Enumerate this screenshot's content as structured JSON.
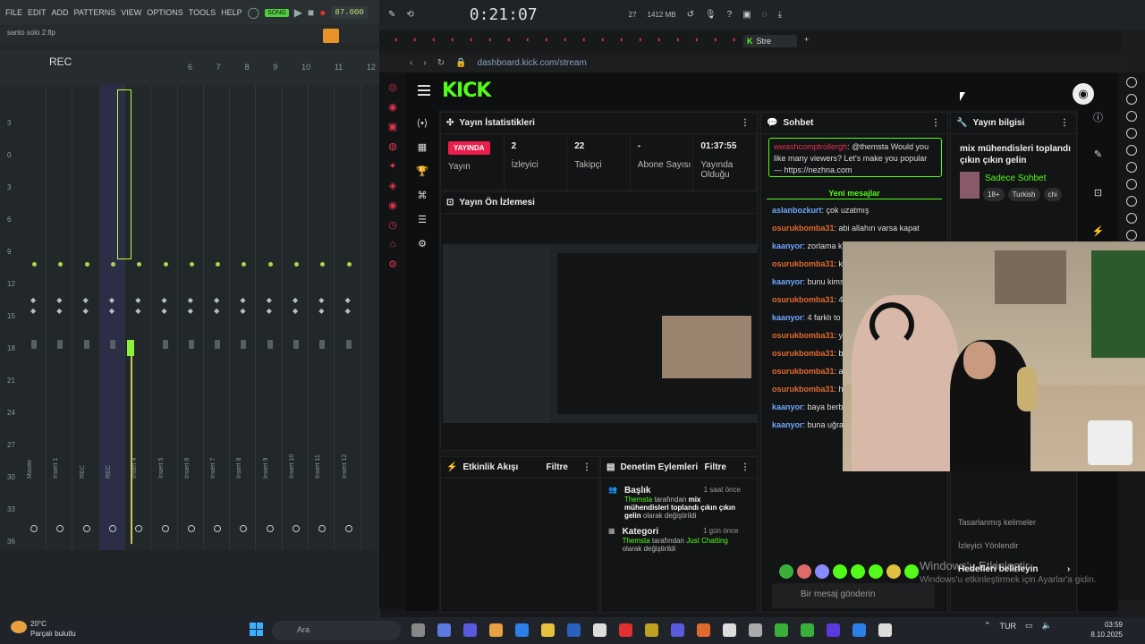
{
  "fl": {
    "menu": [
      "FILE",
      "EDIT",
      "ADD",
      "PATTERNS",
      "VIEW",
      "OPTIONS",
      "TOOLS",
      "HELP"
    ],
    "song_label": "SONG",
    "tempo": "87.000",
    "file_name": "santo solo 2.flp",
    "rec_label": "REC",
    "insert_numbers": [
      "6",
      "7",
      "8",
      "9",
      "10",
      "11",
      "12"
    ],
    "scale": [
      "3",
      "0",
      "3",
      "6",
      "9",
      "12",
      "15",
      "18",
      "21",
      "24",
      "27",
      "30",
      "33",
      "36",
      "39"
    ],
    "tracks": [
      "Master",
      "Insert 1",
      "REC",
      "REC",
      "Insert 4",
      "Insert 5",
      "Insert 6",
      "Insert 7",
      "Insert 8",
      "Insert 9",
      "Insert 10",
      "Insert 11",
      "Insert 12"
    ]
  },
  "toolbar": {
    "timer": "0:21:07",
    "memory": "1412 MB",
    "cpu": "27",
    "zero": "0"
  },
  "browser": {
    "tabs_count": 19,
    "active_tab": "Stre",
    "url": "dashboard.kick.com/stream"
  },
  "kick": {
    "logo": "KICK",
    "stats_title": "Yayın İstatistikleri",
    "live_badge": "YAYINDA",
    "stats": [
      {
        "value": "",
        "label": "Yayın"
      },
      {
        "value": "2",
        "label": "İzleyici"
      },
      {
        "value": "22",
        "label": "Takipçi"
      },
      {
        "value": "-",
        "label": "Abone Sayısı"
      },
      {
        "value": "01:37:55",
        "label": "Yayında Olduğu"
      }
    ],
    "preview_title": "Yayın Ön İzlemesi",
    "activity_title": "Etkinlik Akışı",
    "mod_title": "Denetim Eylemleri",
    "filter_label": "Filtre",
    "mod_items": [
      {
        "title": "Başlık",
        "time": "1 saat önce",
        "actor": "Themsta",
        "text1": "tarafından",
        "value": "mix mühendisleri toplandı çıkın çıkın gelin",
        "text2": "olarak değiştirildi"
      },
      {
        "title": "Kategori",
        "time": "1 gün önce",
        "actor": "Themsta",
        "text1": "tarafından",
        "value": "Just Chatting",
        "text2": "olarak değiştirildi"
      }
    ],
    "chat_title": "Sohbet",
    "pinned": {
      "user": "wwashcomptrollergh",
      "text": "@themsta Would you like many viewers? Let's make you popular — https://nezhna.com"
    },
    "new_messages": "Yeni mesajlar",
    "messages": [
      {
        "user": "aslanbozkurt",
        "color": "#6fa8ff",
        "text": "çok uzatmış"
      },
      {
        "user": "osurukbomba31",
        "color": "#e06a2c",
        "text": "abi allahın varsa kapat"
      },
      {
        "user": "kaanyor",
        "color": "#6fa8ff",
        "text": "zorlama k"
      },
      {
        "user": "osurukbomba31",
        "color": "#e06a2c",
        "text": "k sikebilirmiyim"
      },
      {
        "user": "kaanyor",
        "color": "#6fa8ff",
        "text": "bunu kims"
      },
      {
        "user": "osurukbomba31",
        "color": "#e06a2c",
        "text": "4 osursam seninkind"
      },
      {
        "user": "kaanyor",
        "color": "#6fa8ff",
        "text": "4 farklı to daha çok izleyici ka"
      },
      {
        "user": "osurukbomba31",
        "color": "#e06a2c",
        "text": "y gibi ama vocal osur"
      },
      {
        "user": "osurukbomba31",
        "color": "#e06a2c",
        "text": "b"
      },
      {
        "user": "osurukbomba31",
        "color": "#e06a2c",
        "text": "aq"
      },
      {
        "user": "osurukbomba31",
        "color": "#e06a2c",
        "text": "herhalde bok kafa"
      },
      {
        "user": "kaanyor",
        "color": "#6fa8ff",
        "text": "baya berbat vokal"
      },
      {
        "user": "kaanyor",
        "color": "#6fa8ff",
        "text": "buna uğraşacağıma yok olurdum ya"
      }
    ],
    "chat_placeholder": "Bir mesaj gönderin",
    "info_title": "Yayın bilgisi",
    "stream_title": "mix mühendisleri toplandı çıkın çıkın gelin",
    "category": "Sadece Sohbet",
    "tags": [
      "18+",
      "Turkish",
      "chi"
    ],
    "goals": {
      "line1": "Tasarlanmış kelimeler",
      "line2": "İzleyici Yönlendir",
      "line3": "Hedefleri belirleyin"
    }
  },
  "windows": {
    "activate_title": "Windows'u Etkinleştir",
    "activate_sub": "Windows'u etkinleştirmek için Ayarlar'a gidin.",
    "weather_temp": "20°C",
    "weather_desc": "Parçalı bulutlu",
    "search": "Ara",
    "lang": "TUR",
    "time": "03:59",
    "date": "8.10.2025"
  }
}
